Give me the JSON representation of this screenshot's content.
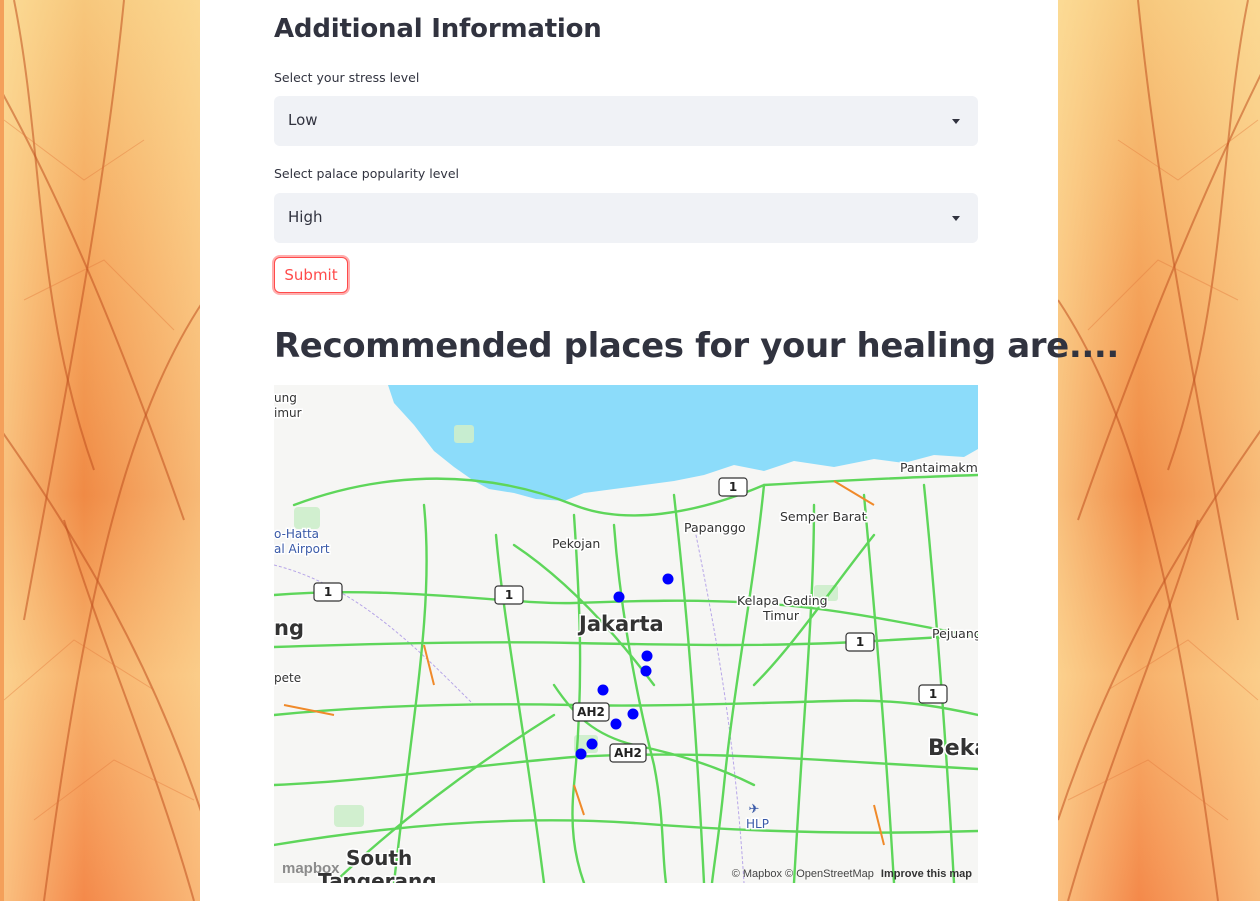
{
  "form": {
    "section_title": "Additional Information",
    "stress": {
      "label": "Select your stress level",
      "value": "Low"
    },
    "popularity": {
      "label": "Select palace popularity level",
      "value": "High"
    },
    "submit_label": "Submit"
  },
  "results": {
    "title": "Recommended places for your healing are...."
  },
  "map": {
    "place_labels": {
      "jakarta": "Jakarta",
      "pekojan": "Pekojan",
      "papanggo": "Papanggo",
      "semper_barat": "Semper Barat",
      "kelapa_gading": "Kelapa Gading",
      "timur": "Timur",
      "pantaimakmur": "Pantaimakm",
      "pejuang": "Pejuang",
      "bekasi": "Beka",
      "south_tangerang_1": "South",
      "south_tangerang_2": "Tangerang",
      "tangerang_left": "ng",
      "pete": "pete",
      "edge_top_1": "ung",
      "edge_top_2": "imur",
      "airport_1": "o-Hatta",
      "airport_2": "al Airport",
      "hlp": "HLP"
    },
    "road_shields": {
      "r1": "1",
      "ah2": "AH2"
    },
    "attribution": "© Mapbox © OpenStreetMap",
    "improve_link": "Improve this map",
    "logo": "mapbox",
    "marker_color": "#0000ff",
    "water_color": "#8cdcfa",
    "road_color": "#5ed65a"
  }
}
